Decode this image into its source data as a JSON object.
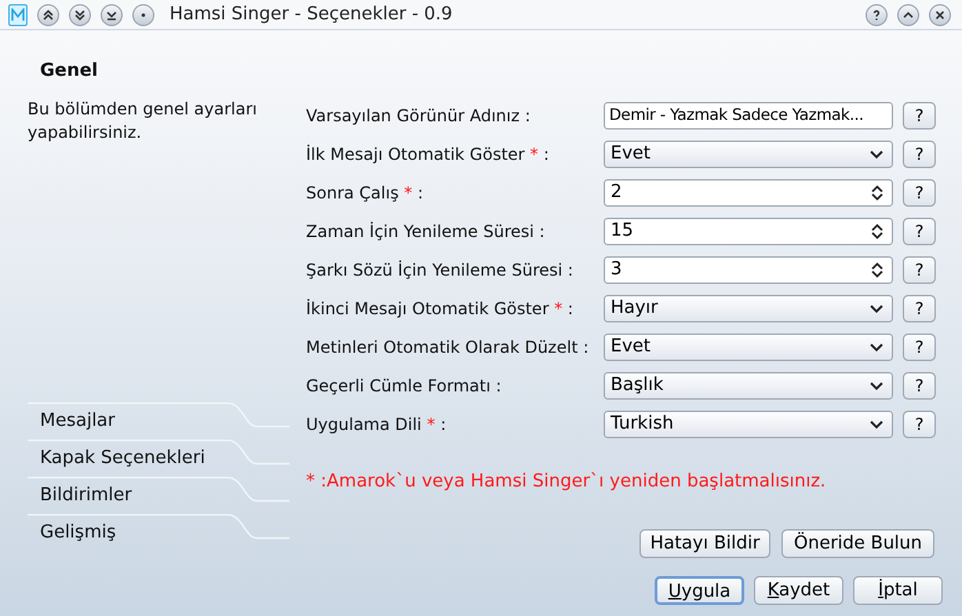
{
  "window": {
    "title": "Hamsi Singer - Seçenekler - 0.9"
  },
  "section": {
    "title": "Genel",
    "description": "Bu bölümden genel ayarları yapabilirsiniz."
  },
  "sidebar_tabs": [
    {
      "label": "Mesajlar",
      "selected": false
    },
    {
      "label": "Kapak Seçenekleri",
      "selected": false
    },
    {
      "label": "Bildirimler",
      "selected": false
    },
    {
      "label": "Gelişmiş",
      "selected": false
    }
  ],
  "settings": [
    {
      "label": "Varsayılan Görünür Adınız",
      "suffix": ":",
      "kind": "text",
      "value": "Demir - Yazmak Sadece Yazmak...",
      "help": "?"
    },
    {
      "label": "İlk Mesajı Otomatik Göster",
      "mark": "*",
      "suffix": ":",
      "kind": "select",
      "value": "Evet",
      "help": "?"
    },
    {
      "label": "Sonra Çalış",
      "mark": "*",
      "suffix": ":",
      "kind": "spin",
      "value": "2",
      "help": "?"
    },
    {
      "label": "Zaman İçin Yenileme Süresi",
      "suffix": ":",
      "kind": "spin",
      "value": "15",
      "help": "?"
    },
    {
      "label": "Şarkı Sözü İçin Yenileme Süresi",
      "suffix": ":",
      "kind": "spin",
      "value": "3",
      "help": "?"
    },
    {
      "label": "İkinci Mesajı Otomatik Göster",
      "mark": "*",
      "suffix": ":",
      "kind": "select",
      "value": "Hayır",
      "help": "?"
    },
    {
      "label": "Metinleri Otomatik Olarak Düzelt",
      "suffix": ":",
      "kind": "select",
      "value": "Evet",
      "help": "?"
    },
    {
      "label": "Geçerli Cümle Formatı",
      "suffix": ":",
      "kind": "select",
      "value": "Başlık",
      "help": "?"
    },
    {
      "label": "Uygulama Dili",
      "mark": "*",
      "suffix": ":",
      "kind": "select",
      "value": "Turkish",
      "help": "?"
    }
  ],
  "note": "* :Amarok`u veya Hamsi Singer`ı yeniden başlatmalısınız.",
  "extra_buttons": [
    "Hatayı Bildir",
    "Öneride Bulun"
  ],
  "dialog_buttons": [
    {
      "accel": "U",
      "rest": "ygula",
      "focused": true
    },
    {
      "accel": "K",
      "rest": "aydet",
      "focused": false
    },
    {
      "accel": "İ",
      "rest": "ptal",
      "focused": false
    }
  ]
}
